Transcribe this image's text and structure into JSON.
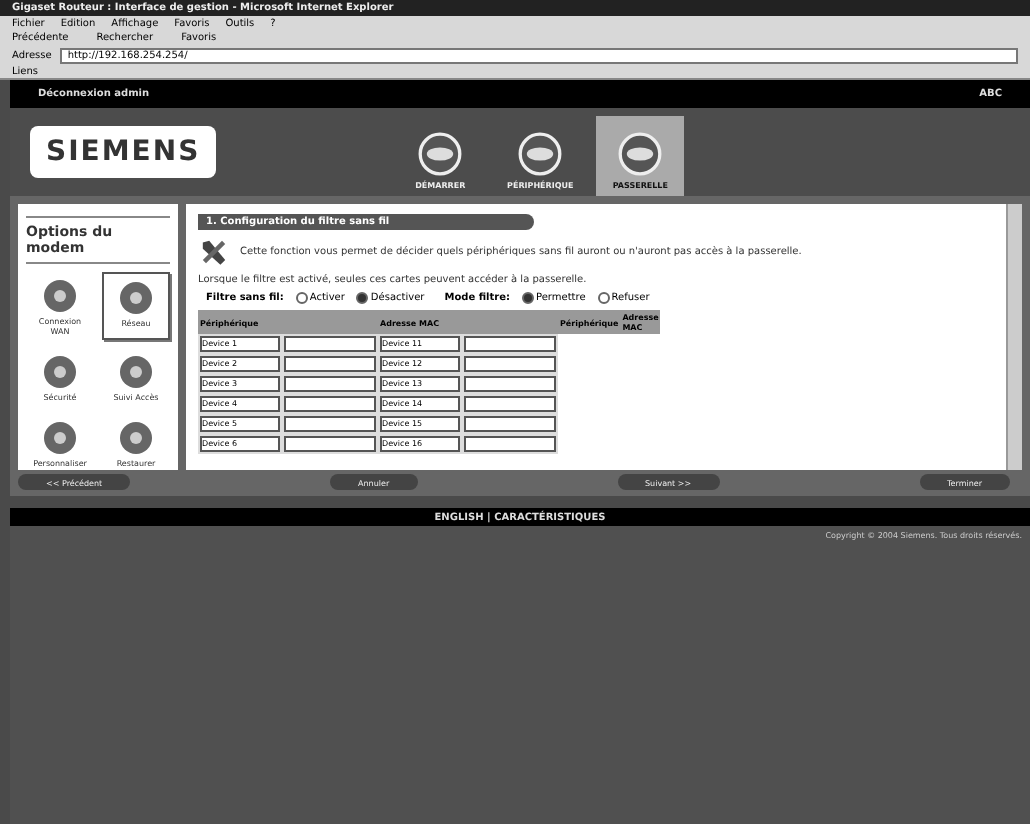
{
  "window": {
    "title": "Gigaset Routeur : Interface de gestion - Microsoft Internet Explorer"
  },
  "menu": [
    "Fichier",
    "Edition",
    "Affichage",
    "Favoris",
    "Outils",
    "?"
  ],
  "toolbar": [
    "Précédente",
    "Rechercher",
    "Favoris"
  ],
  "address": {
    "label": "Adresse",
    "value": "http://192.168.254.254/"
  },
  "links_label": "Liens",
  "top_bar": {
    "logout": "Déconnexion admin",
    "right": "ABC"
  },
  "logo": "SIEMENS",
  "tabs": [
    {
      "label": "DÉMARRER",
      "selected": false
    },
    {
      "label": "PÉRIPHÉRIQUE",
      "selected": false
    },
    {
      "label": "PASSERELLE",
      "selected": true
    }
  ],
  "sidebar": {
    "title": "Options du modem",
    "items": [
      {
        "label": "Connexion WAN",
        "selected": false
      },
      {
        "label": "Réseau",
        "selected": true
      },
      {
        "label": "Sécurité",
        "selected": false
      },
      {
        "label": "Suivi Accès",
        "selected": false
      },
      {
        "label": "Personnaliser",
        "selected": false
      },
      {
        "label": "Restaurer",
        "selected": false
      }
    ]
  },
  "section": {
    "title": "1. Configuration du filtre sans fil",
    "intro": "Cette fonction vous permet de décider quels périphériques sans fil auront ou n'auront pas accès à la passerelle.",
    "note": "Lorsque le filtre est activé, seules ces cartes peuvent accéder à la passerelle.",
    "options": [
      {
        "label": "Filtre sans fil:",
        "choices": [
          {
            "label": "Activer",
            "selected": false
          },
          {
            "label": "Désactiver",
            "selected": true
          }
        ]
      },
      {
        "label": "Mode filtre:",
        "choices": [
          {
            "label": "Permettre",
            "selected": true
          },
          {
            "label": "Refuser",
            "selected": false
          }
        ]
      }
    ],
    "columns": [
      "Périphérique",
      "Adresse MAC",
      "Périphérique",
      "Adresse MAC"
    ],
    "rows": [
      [
        "Device 1",
        "Device 11"
      ],
      [
        "Device 2",
        "Device 12"
      ],
      [
        "Device 3",
        "Device 13"
      ],
      [
        "Device 4",
        "Device 14"
      ],
      [
        "Device 5",
        "Device 15"
      ],
      [
        "Device 6",
        "Device 16"
      ]
    ]
  },
  "buttons": [
    "<< Précédent",
    "Annuler",
    "Suivant >>",
    "Terminer"
  ],
  "footer": {
    "links": "ENGLISH | CARACTÉRISTIQUES",
    "copyright": "Copyright © 2004 Siemens. Tous droits réservés."
  }
}
